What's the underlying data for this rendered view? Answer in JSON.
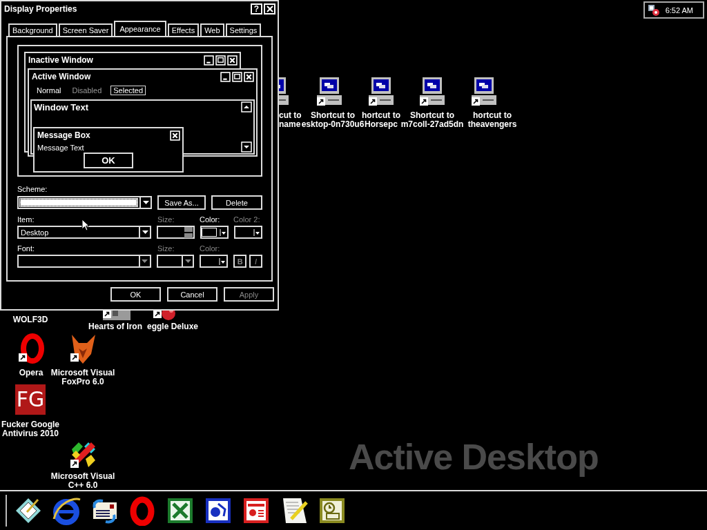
{
  "desktop_icons": [
    {
      "kind": "computer",
      "lines": [
        "cut to",
        "name"
      ]
    },
    {
      "kind": "computer",
      "lines": [
        "Shortcut to",
        "esktop-0n730u6"
      ]
    },
    {
      "kind": "computer",
      "lines": [
        "hortcut to",
        "Horsepc"
      ]
    },
    {
      "kind": "computer",
      "lines": [
        "Shortcut to",
        "m7coll-27ad5dn"
      ]
    },
    {
      "kind": "computer",
      "lines": [
        "hortcut to",
        "theavengers"
      ]
    },
    {
      "lines": [
        "WOLF3D"
      ]
    },
    {
      "kind": "grey",
      "lines": [
        "Hearts of Iron"
      ]
    },
    {
      "kind": "ball",
      "lines": [
        "eggle Deluxe"
      ]
    },
    {
      "kind": "opera",
      "lines": [
        "Opera"
      ]
    },
    {
      "kind": "fox",
      "lines": [
        "Microsoft Visual",
        "FoxPro 6.0"
      ]
    },
    {
      "kind": "logo",
      "badge": "FG",
      "lines": [
        "Fucker Google",
        "Antivirus 2010"
      ]
    },
    {
      "kind": "puzzle",
      "lines": [
        "Microsoft Visual",
        "C++ 6.0"
      ]
    }
  ],
  "brand": "Active Desktop",
  "tray": {
    "time": "6:52 AM"
  },
  "dialog": {
    "title": "Display Properties",
    "help": "?",
    "tabs": [
      {
        "label": "Background",
        "selected": false
      },
      {
        "label": "Screen Saver",
        "selected": false
      },
      {
        "label": "Appearance",
        "selected": true
      },
      {
        "label": "Effects",
        "selected": false
      },
      {
        "label": "Web",
        "selected": false
      },
      {
        "label": "Settings",
        "selected": false
      }
    ],
    "preview": {
      "inactive_title": "Inactive Window",
      "active_title": "Active Window",
      "menu": [
        {
          "label": "Normal",
          "disabled": false,
          "selected": false
        },
        {
          "label": "Disabled",
          "disabled": true,
          "selected": false
        },
        {
          "label": "Selected",
          "disabled": false,
          "selected": true
        }
      ],
      "window_text": "Window Text",
      "message_title": "Message Box",
      "message_text": "Message Text",
      "ok": "OK"
    },
    "scheme": {
      "label": "Scheme:",
      "focused": true,
      "buttons": [
        "Save As...",
        "Delete"
      ]
    },
    "item": {
      "label": "Item:",
      "value": "Desktop"
    },
    "item_size": {
      "label": "Size:",
      "disabled": true
    },
    "item_color": {
      "label": "Color:",
      "disabled": false
    },
    "item_color2": {
      "label": "Color 2:",
      "disabled": true
    },
    "font": {
      "label": "Font:",
      "disabled": true
    },
    "font_size": {
      "label": "Size:",
      "disabled": true
    },
    "font_color": {
      "label": "Color:",
      "disabled": true
    },
    "bold": {
      "label": "B",
      "disabled": true
    },
    "italic": {
      "label": "I",
      "disabled": true
    },
    "footer_buttons": [
      {
        "label": "OK",
        "disabled": false
      },
      {
        "label": "Cancel",
        "disabled": false
      },
      {
        "label": "Apply",
        "disabled": true
      }
    ]
  },
  "taskbar": [
    {
      "kind": "desktop"
    },
    {
      "kind": "browser"
    },
    {
      "kind": "mail"
    },
    {
      "kind": "opera"
    },
    {
      "kind": "sheet"
    },
    {
      "kind": "publisher"
    },
    {
      "kind": "slides"
    },
    {
      "kind": "notepad"
    },
    {
      "kind": "calendar"
    }
  ]
}
